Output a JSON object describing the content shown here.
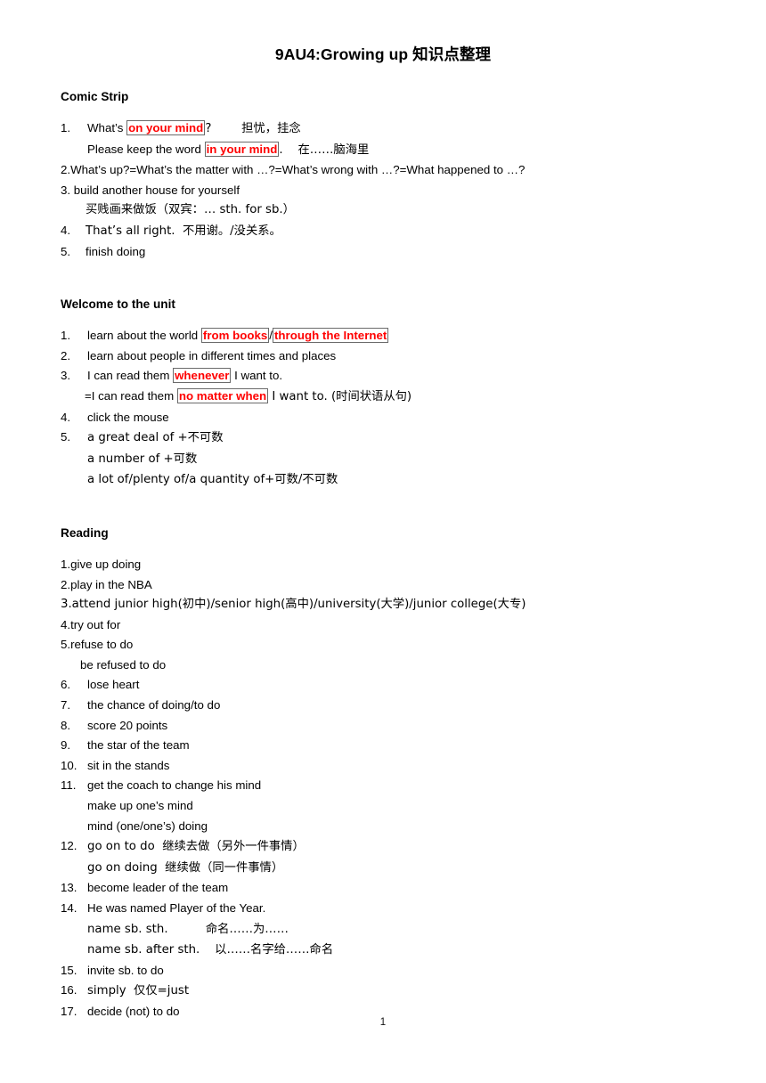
{
  "document": {
    "title": "9AU4:Growing up 知识点整理",
    "page_number": "1",
    "accent_color": "#ff0000",
    "box_border_color": "#6b6b6b"
  },
  "sections": [
    {
      "heading": "Comic Strip",
      "lines": [
        {
          "num": "1.",
          "pre": "What’s ",
          "hl": "on your mind",
          "post": "?        担忧，挂念"
        },
        {
          "num": "",
          "pre": "Please keep the word ",
          "hl": "in your mind",
          "post": ".    在……脑海里"
        },
        {
          "num": "",
          "pre": "2.What’s up?=What’s the matter with …?=What’s wrong with …?=What happened to …?",
          "hl": "",
          "post": ""
        },
        {
          "num": "",
          "pre": "3. build another house for yourself",
          "hl": "",
          "post": ""
        },
        {
          "num": "",
          "pre": "买贱画来做饭（双宾：… sth. for sb.）",
          "hl": "",
          "post": ""
        },
        {
          "num": "4.",
          "pre": "That’s all right.  不用谢。/没关系。",
          "hl": "",
          "post": ""
        },
        {
          "num": "5.",
          "pre": "finish doing",
          "hl": "",
          "post": ""
        }
      ]
    },
    {
      "heading": "Welcome to the unit",
      "lines": [
        {
          "num": "1.",
          "pre": "learn about the world ",
          "hl": "from books",
          "mid": "/",
          "hl2": "through the Internet",
          "post": ""
        },
        {
          "num": "2.",
          "pre": "learn about people in different times and places",
          "hl": "",
          "post": ""
        },
        {
          "num": "3.",
          "pre": "I can read them ",
          "hl": "whenever",
          "post": " I want to."
        },
        {
          "num": "",
          "pre": "=I can read them ",
          "hl": "no matter when",
          "post": " I want to. (时间状语从句)"
        },
        {
          "num": "4.",
          "pre": "click the mouse",
          "hl": "",
          "post": ""
        },
        {
          "num": "5.",
          "pre": "a great deal of +不可数",
          "hl": "",
          "post": ""
        },
        {
          "num": "",
          "pre": "a number of +可数",
          "hl": "",
          "post": ""
        },
        {
          "num": "",
          "pre": "a lot of/plenty of/a quantity of+可数/不可数",
          "hl": "",
          "post": ""
        }
      ]
    },
    {
      "heading": "Reading",
      "lines": [
        {
          "num": "",
          "pre": "1.give up doing",
          "hl": "",
          "post": ""
        },
        {
          "num": "",
          "pre": "2.play in the NBA",
          "hl": "",
          "post": ""
        },
        {
          "num": "",
          "pre": "3.attend junior high(初中)/senior high(高中)/university(大学)/junior college(大专)",
          "hl": "",
          "post": ""
        },
        {
          "num": "",
          "pre": "4.try out for",
          "hl": "",
          "post": ""
        },
        {
          "num": "",
          "pre": "5.refuse to do",
          "hl": "",
          "post": ""
        },
        {
          "num": "",
          "pre": "be refused to do",
          "hl": "",
          "post": ""
        },
        {
          "num": "6.",
          "pre": "lose heart",
          "hl": "",
          "post": ""
        },
        {
          "num": "7.",
          "pre": "the chance of doing/to do",
          "hl": "",
          "post": ""
        },
        {
          "num": "8.",
          "pre": "score 20 points",
          "hl": "",
          "post": ""
        },
        {
          "num": "9.",
          "pre": "the star of the team",
          "hl": "",
          "post": ""
        },
        {
          "num": "10.",
          "pre": "sit in the stands",
          "hl": "",
          "post": ""
        },
        {
          "num": "11.",
          "pre": "get the coach to change his mind",
          "hl": "",
          "post": ""
        },
        {
          "num": "",
          "pre": "make up one’s mind",
          "hl": "",
          "post": ""
        },
        {
          "num": "",
          "pre": "mind (one/one’s) doing",
          "hl": "",
          "post": ""
        },
        {
          "num": "12.",
          "pre": "go on to do  继续去做（另外一件事情）",
          "hl": "",
          "post": ""
        },
        {
          "num": "",
          "pre": "go on doing  继续做（同一件事情）",
          "hl": "",
          "post": ""
        },
        {
          "num": "13.",
          "pre": "become leader of the team",
          "hl": "",
          "post": ""
        },
        {
          "num": "14.",
          "pre": "He was named Player of the Year.",
          "hl": "",
          "post": ""
        },
        {
          "num": "",
          "pre": "name sb. sth.          命名……为……",
          "hl": "",
          "post": ""
        },
        {
          "num": "",
          "pre": "name sb. after sth.    以……名字给……命名",
          "hl": "",
          "post": ""
        },
        {
          "num": "15.",
          "pre": "invite sb. to do",
          "hl": "",
          "post": ""
        },
        {
          "num": "16.",
          "pre": "simply  仅仅=just",
          "hl": "",
          "post": ""
        },
        {
          "num": "17.",
          "pre": "decide (not) to do",
          "hl": "",
          "post": ""
        }
      ]
    }
  ]
}
